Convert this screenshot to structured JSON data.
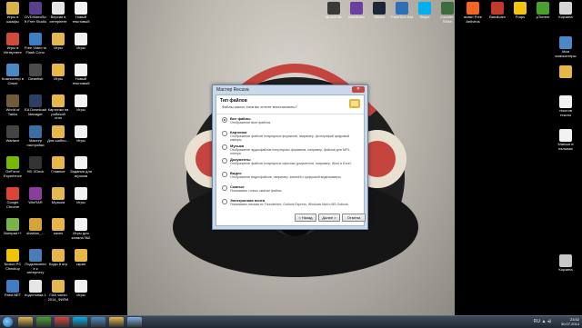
{
  "desktop": {
    "left_icons": [
      {
        "label": "Игры в шкафы",
        "color": "#d8b34a"
      },
      {
        "label": "Игры в Интернете",
        "color": "#d04b3a"
      },
      {
        "label": "Компьютер в Ольге",
        "color": "#4c87c6"
      },
      {
        "label": "World of Tanks",
        "color": "#6f5b3a"
      },
      {
        "label": "Warface",
        "color": "#444444"
      },
      {
        "label": "GeForce Experience",
        "color": "#76b900"
      },
      {
        "label": "Google Chrome",
        "color": "#db4437"
      },
      {
        "label": "Notepad++",
        "color": "#7bb34b"
      },
      {
        "label": "Norton PC Checkup",
        "color": "#f2c300"
      },
      {
        "label": "Paint.NET",
        "color": "#3f7cc2"
      }
    ],
    "col2_icons": [
      {
        "label": "DVDVideoSoft Free Studio",
        "color": "#5a3f8a"
      },
      {
        "label": "Free Video to Flash Conv.",
        "color": "#3b7fc1"
      },
      {
        "label": "Cleanfish",
        "color": "#4b4b4b"
      },
      {
        "label": "EA Download Manager",
        "color": "#2c3e62"
      },
      {
        "label": "Мастер настройки",
        "color": "#3a6ea5"
      },
      {
        "label": "HD VDeck",
        "color": "#333333"
      },
      {
        "label": "WinRAR",
        "color": "#8b3d9e"
      },
      {
        "label": "shablon_...",
        "color": "#d6a43a"
      },
      {
        "label": "Подключение к интернету",
        "color": "#4a7db5"
      },
      {
        "label": "подготовка 1",
        "color": "#e6e6e6"
      }
    ],
    "col3_icons": [
      {
        "label": "Версия в интернете",
        "color": "#e6e6e6"
      },
      {
        "label": "Игры",
        "color": "#e6b84a"
      },
      {
        "label": "Игры",
        "color": "#e6b84a"
      },
      {
        "label": "Картинки на рабочий стол",
        "color": "#e6b84a"
      },
      {
        "label": "Для шабло...",
        "color": "#e6b84a"
      },
      {
        "label": "Главное",
        "color": "#e6b84a"
      },
      {
        "label": "Музыка",
        "color": "#e6b84a"
      },
      {
        "label": "saves",
        "color": "#e6b84a"
      },
      {
        "label": "Коды 8 игр",
        "color": "#e6b84a"
      },
      {
        "label": "ГИА части 2014_ФИПИ",
        "color": "#e6b84a"
      }
    ],
    "col4_icons": [
      {
        "label": "Новый текстовый",
        "color": "#f2f2f2"
      },
      {
        "label": "Игры",
        "color": "#f2f2f2"
      },
      {
        "label": "Новый текстовый",
        "color": "#f2f2f2"
      },
      {
        "label": "Игры",
        "color": "#f2f2f2"
      },
      {
        "label": "Игры",
        "color": "#f2f2f2"
      },
      {
        "label": "Задания для игроков",
        "color": "#f2f2f2"
      },
      {
        "label": "Игры",
        "color": "#f2f2f2"
      },
      {
        "label": "Игры для канала №2",
        "color": "#f2f2f2"
      },
      {
        "label": "скрин",
        "color": "#e6b84a"
      },
      {
        "label": "Игры",
        "color": "#f2f2f2"
      }
    ],
    "top_icons": [
      {
        "label": "lib-sofi file",
        "color": "#3a3a3a"
      },
      {
        "label": "Bandicam",
        "color": "#6a3fa0"
      },
      {
        "label": "Steam",
        "color": "#1b2838"
      },
      {
        "label": "PaintTool SAI",
        "color": "#2e6fb5"
      },
      {
        "label": "Skype",
        "color": "#00aff0"
      },
      {
        "label": "Counter-Strike",
        "color": "#3c6e3c"
      },
      {
        "label": "avast! Free Antivirus",
        "color": "#f26522"
      },
      {
        "label": "Bandicam",
        "color": "#c0392b"
      },
      {
        "label": "Fraps",
        "color": "#f1c40f"
      },
      {
        "label": "µTorrent",
        "color": "#4aa02c"
      }
    ],
    "right_icons": [
      {
        "label": "Корзина",
        "color": "#d6d6d6"
      },
      {
        "label": "Мои компьютеры",
        "color": "#4c87c6"
      },
      {
        "label": "",
        "color": "#e6b84a"
      },
      {
        "label": "текстов тексты",
        "color": "#f2f2f2"
      },
      {
        "label": "Маньки в пальмах",
        "color": "#f2f2f2"
      },
      {
        "label": "Корзина",
        "color": "#c8c8c8"
      }
    ]
  },
  "dialog": {
    "title": "Мастер Recuva",
    "close_label": "✕",
    "heading": "Тип файлов",
    "subheading": "Файлы какого типа вы хотите восстановить?",
    "options": [
      {
        "title": "Все файлы",
        "desc": "Отображение всех файлов.",
        "selected": true
      },
      {
        "title": "Картинки",
        "desc": "Отображение файлов популярных форматов, например, фотографий цифровой камеры.",
        "selected": false
      },
      {
        "title": "Музыка",
        "desc": "Отображение аудиофайлов популярных форматов, например, файлов для MP3-плеера.",
        "selected": false
      },
      {
        "title": "Документы",
        "desc": "Отображение файлов популярных офисных документов, например, Word и Excel.",
        "selected": false
      },
      {
        "title": "Видео",
        "desc": "Отображение видеофайлов, например, записей с цифровой видеокамеры.",
        "selected": false
      },
      {
        "title": "Сжатые",
        "desc": "Показывать только сжатые файлы.",
        "selected": false
      },
      {
        "title": "Электронная почта",
        "desc": "Показывать письма из Thunderbird, Outlook Express, Windows Mail и MS Outlook.",
        "selected": false
      }
    ],
    "buttons": {
      "back": "< Назад",
      "next": "Далее >",
      "cancel": "Отмена"
    }
  },
  "taskbar": {
    "pinned": [
      {
        "name": "explorer",
        "color": "#e6b84a"
      },
      {
        "name": "utorrent",
        "color": "#4aa02c"
      },
      {
        "name": "chrome",
        "color": "#db4437"
      },
      {
        "name": "skype",
        "color": "#00aff0"
      },
      {
        "name": "media",
        "color": "#4c87c6"
      },
      {
        "name": "files",
        "color": "#e6b84a"
      },
      {
        "name": "recuva",
        "color": "#7fb0de"
      }
    ],
    "tray": "RU ▲ ◂)",
    "time": "23:52",
    "date": "30.07.2014"
  }
}
